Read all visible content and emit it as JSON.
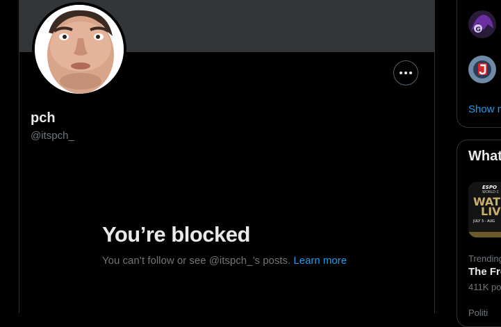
{
  "profile": {
    "display_name": "pch",
    "handle": "@itspch_"
  },
  "blocked": {
    "title": "You’re blocked",
    "message": "You can’t follow or see @itspch_’s posts.",
    "learn_more": "Learn more"
  },
  "right_sidebar": {
    "show_more": "Show m",
    "whats_happening": "What",
    "trend": {
      "thumb_top": "ESPO",
      "thumb_sub": "WORLD C",
      "thumb_wat": "WAT",
      "thumb_liv": "LIV",
      "thumb_date": "JULY 3 - AUG",
      "meta": "Trending",
      "name": "The Fre",
      "count": "411K pos",
      "meta2": "Politi"
    }
  },
  "colors": {
    "accent": "#1d9bf0",
    "background": "#000000",
    "banner": "#333639",
    "border": "#2f3336",
    "muted_text": "#71767b"
  }
}
